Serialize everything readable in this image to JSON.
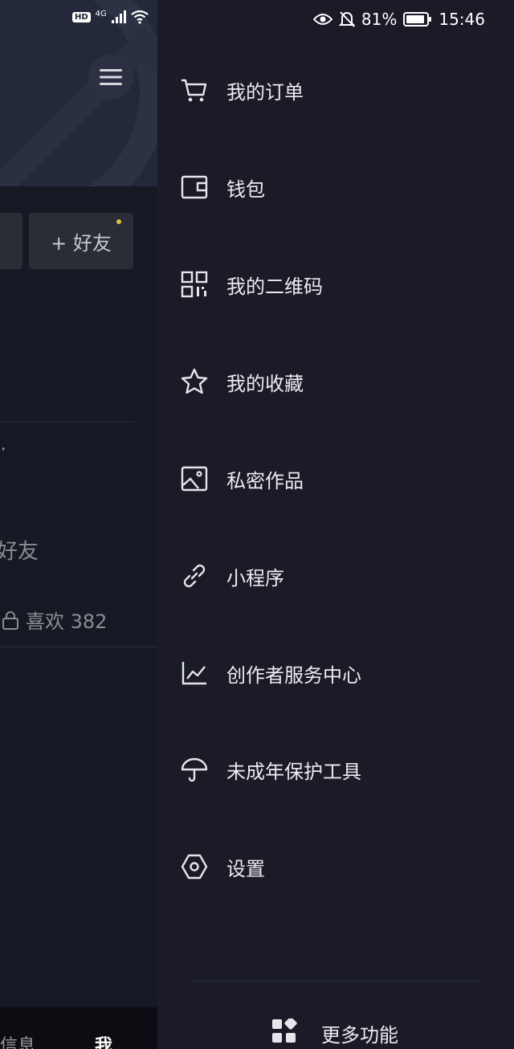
{
  "status_bar": {
    "left_badge": "HD",
    "network": "4G",
    "battery": "81%",
    "time": "15:46"
  },
  "background_page": {
    "add_friend_label": "+ 好友",
    "friend_fragment": "好友",
    "likes_label": "喜欢 382",
    "bottom_nav_left_fragment": "信息",
    "bottom_nav_me": "我"
  },
  "drawer": {
    "items": [
      {
        "label": "我的订单",
        "icon": "cart-icon"
      },
      {
        "label": "钱包",
        "icon": "wallet-icon"
      },
      {
        "label": "我的二维码",
        "icon": "qrcode-icon"
      },
      {
        "label": "我的收藏",
        "icon": "star-icon"
      },
      {
        "label": "私密作品",
        "icon": "image-icon"
      },
      {
        "label": "小程序",
        "icon": "link-icon"
      },
      {
        "label": "创作者服务中心",
        "icon": "chart-icon"
      },
      {
        "label": "未成年保护工具",
        "icon": "umbrella-icon"
      },
      {
        "label": "设置",
        "icon": "settings-icon"
      }
    ],
    "more_label": "更多功能"
  }
}
